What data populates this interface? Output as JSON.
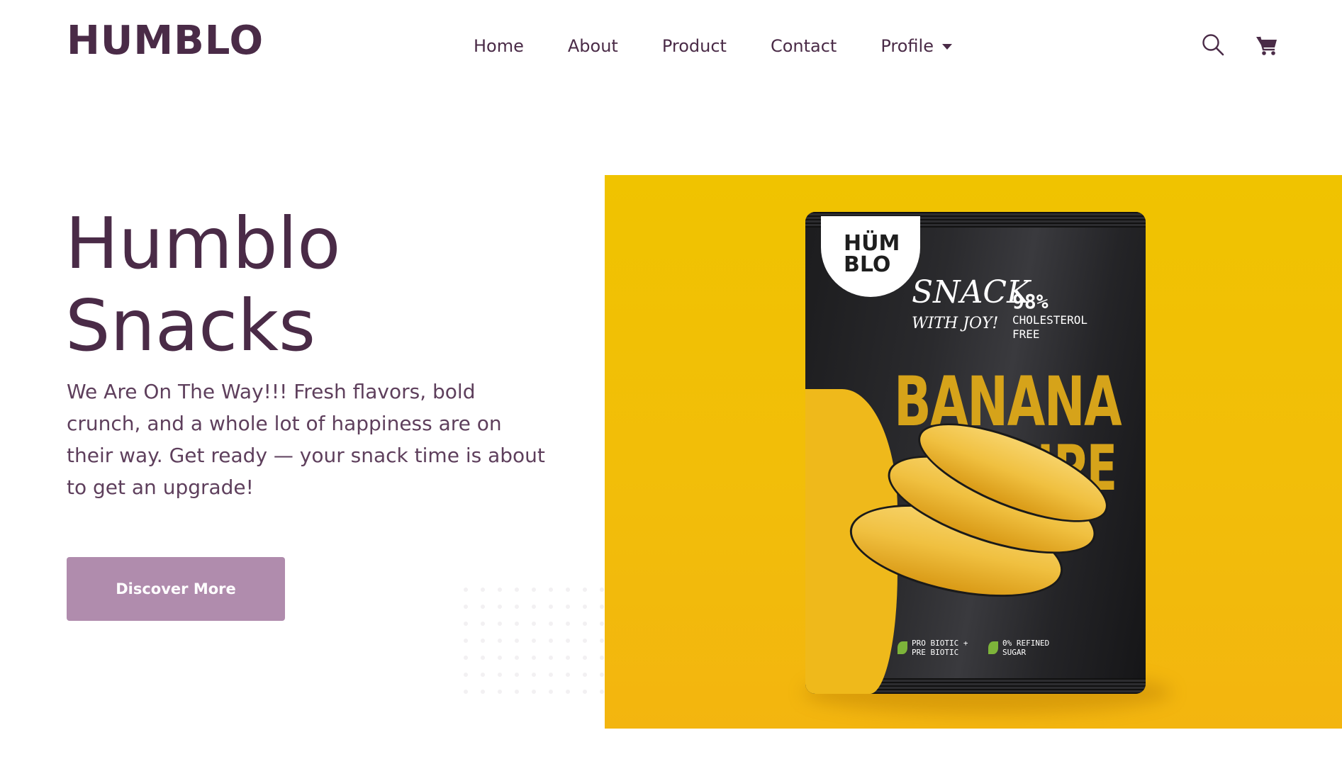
{
  "brand": {
    "logo": "HUMBLO",
    "color": "#4a2b47"
  },
  "nav": {
    "items": [
      {
        "label": "Home"
      },
      {
        "label": "About"
      },
      {
        "label": "Product"
      },
      {
        "label": "Contact"
      },
      {
        "label": "Profile",
        "has_dropdown": true
      }
    ]
  },
  "header_icons": {
    "search": "search-icon",
    "cart": "shopping-cart-icon"
  },
  "hero": {
    "title_line1": "Humblo",
    "title_line2": "Snacks",
    "description": "We Are On The Way!!! Fresh flavors, bold crunch, and a whole lot of happiness are on their way. Get ready — your snack time is about to get an upgrade!",
    "cta_label": "Discover More",
    "cta_color": "#b08cad"
  },
  "product_image": {
    "panel_color": "#f0c300",
    "bag_logo_line1": "HÜM",
    "bag_logo_line2": "BLO",
    "tagline_line1": "SNACK",
    "tagline_line2": "WITH JOY!",
    "stat_percent": "98%",
    "stat_line1": "CHOLESTEROL",
    "stat_line2": "FREE",
    "product_name_line1": "BANANA",
    "product_name_line2": "RIPE",
    "badge1_line1": "PRO BIOTIC +",
    "badge1_line2": "PRE BIOTIC",
    "badge2_line1": "0% REFINED",
    "badge2_line2": "SUGAR"
  }
}
